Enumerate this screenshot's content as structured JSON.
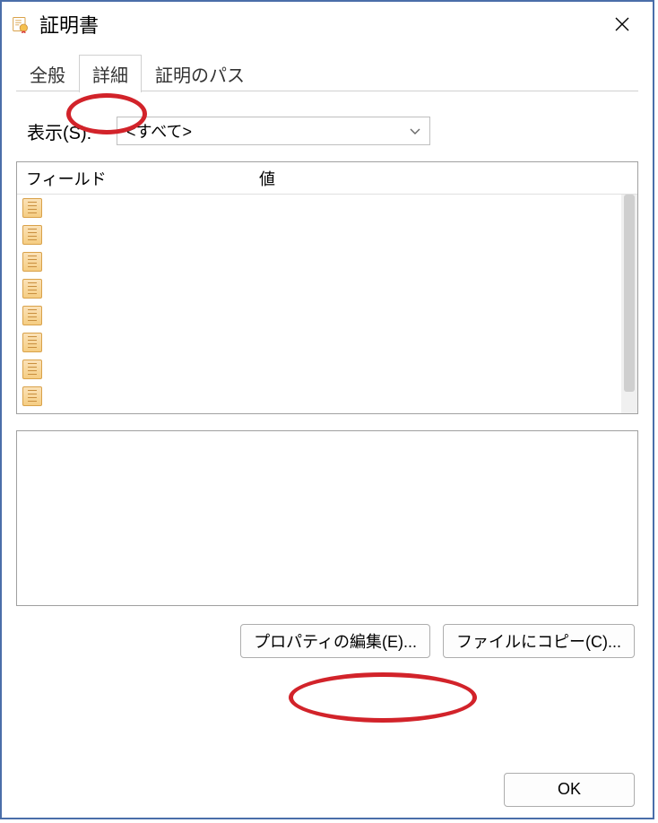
{
  "window": {
    "title": "証明書"
  },
  "tabs": {
    "general": "全般",
    "details": "詳細",
    "path": "証明のパス",
    "selected_index": 1
  },
  "show": {
    "label": "表示(S):",
    "selected": "<すべて>"
  },
  "list": {
    "header_field": "フィールド",
    "header_value": "値"
  },
  "buttons": {
    "edit_properties": "プロパティの編集(E)...",
    "copy_to_file": "ファイルにコピー(C)...",
    "ok": "OK"
  },
  "highlights": {
    "tab_details": true,
    "edit_properties_button": true
  },
  "icons": {
    "certificate": "certificate-icon",
    "close": "close-icon",
    "chevron_down": "chevron-down-icon"
  }
}
